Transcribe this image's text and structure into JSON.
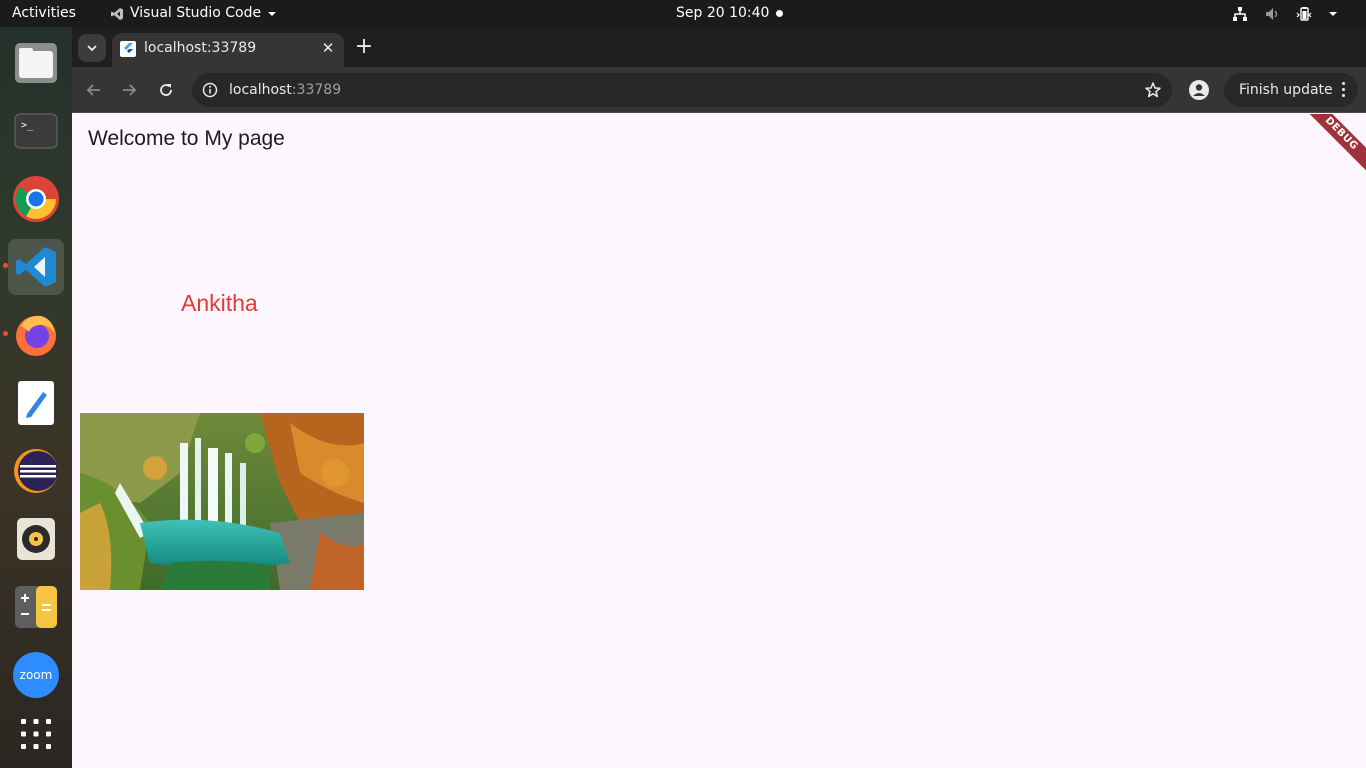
{
  "topbar": {
    "activities": "Activities",
    "app_name": "Visual Studio Code",
    "clock": "Sep 20  10:40"
  },
  "dock": {
    "items": [
      "files-icon",
      "terminal-icon",
      "chrome-icon",
      "vscode-icon",
      "firefox-icon",
      "text-editor-icon",
      "eclipse-icon",
      "rhythmbox-icon",
      "calculator-icon",
      "zoom-icon",
      "app-grid-icon"
    ],
    "zoom_label": "zoom",
    "terminal_glyph": ">_"
  },
  "browser": {
    "tab_title": "localhost:33789",
    "url_host": "localhost",
    "url_port": ":33789",
    "finish_update": "Finish update"
  },
  "page": {
    "heading": "Welcome to My page",
    "name": "Ankitha",
    "debug_banner": "DEBUG"
  },
  "colors": {
    "page_background": "#fdf7fd",
    "name_text": "#e53935",
    "debug_banner": "#a0323b"
  }
}
